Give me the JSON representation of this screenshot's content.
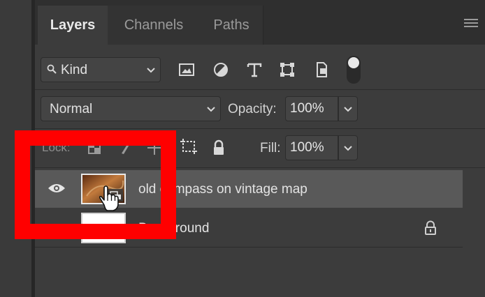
{
  "tabs": [
    {
      "label": "Layers",
      "active": true
    },
    {
      "label": "Channels",
      "active": false
    },
    {
      "label": "Paths",
      "active": false
    }
  ],
  "filter": {
    "kind_label": "Kind",
    "icons": [
      "image-filter-icon",
      "adjustment-filter-icon",
      "type-filter-icon",
      "shape-filter-icon",
      "smart-object-filter-icon"
    ],
    "toggle_on": true
  },
  "blend": {
    "mode": "Normal",
    "opacity_label": "Opacity:",
    "opacity_value": "100%",
    "fill_label": "Fill:",
    "fill_value": "100%"
  },
  "lock": {
    "label": "Lock:",
    "icons": [
      "lock-transparent-icon",
      "lock-image-icon",
      "lock-position-icon",
      "lock-artboard-icon",
      "lock-all-icon"
    ]
  },
  "layers": [
    {
      "name": "old compass on vintage map",
      "selected": true,
      "visible": true,
      "smart_object": true
    },
    {
      "name": "Background",
      "selected": false,
      "visible": true,
      "locked": true
    }
  ],
  "colors": {
    "highlight": "#ff0000",
    "selected_row": "#595959",
    "panel_bg": "#3c3c3c"
  }
}
